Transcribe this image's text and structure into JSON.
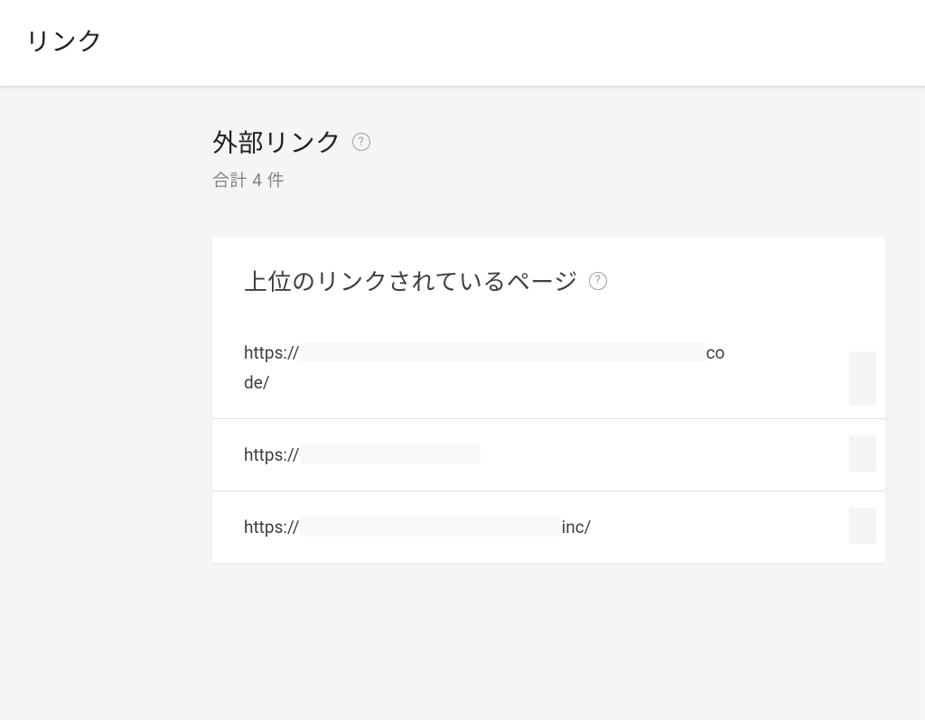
{
  "header": {
    "title": "リンク"
  },
  "section": {
    "title": "外部リンク",
    "subtitle": "合計 4 件"
  },
  "card": {
    "title": "上位のリンクされているページ",
    "rows": [
      {
        "prefix": "https://",
        "suffix_inline": "co",
        "suffix_wrap": "de/"
      },
      {
        "prefix": "https://",
        "suffix_inline": "",
        "suffix_wrap": ""
      },
      {
        "prefix": "https://",
        "suffix_inline": "inc/",
        "suffix_wrap": ""
      }
    ]
  },
  "help_glyph": "?"
}
